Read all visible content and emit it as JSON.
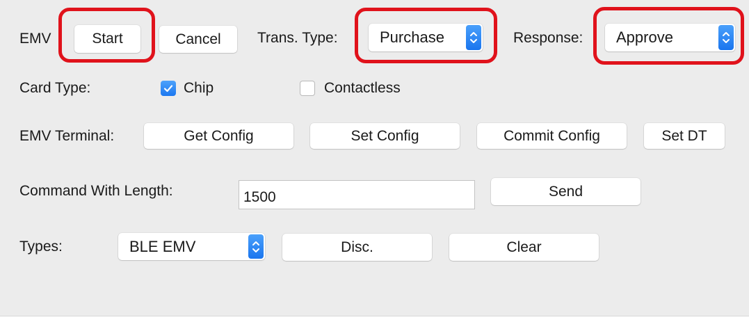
{
  "emv": {
    "label": "EMV",
    "start_button": "Start",
    "cancel_button": "Cancel"
  },
  "trans_type": {
    "label": "Trans. Type:",
    "selected": "Purchase"
  },
  "response": {
    "label": "Response:",
    "selected": "Approve"
  },
  "card_type": {
    "label": "Card Type:",
    "chip": {
      "label": "Chip",
      "checked": true
    },
    "contactless": {
      "label": "Contactless",
      "checked": false
    }
  },
  "emv_terminal": {
    "label": "EMV Terminal:",
    "get_config": "Get Config",
    "set_config": "Set Config",
    "commit_config": "Commit Config",
    "set_dt": "Set DT"
  },
  "command": {
    "label": "Command With Length:",
    "value": "1500",
    "send_button": "Send"
  },
  "types": {
    "label": "Types:",
    "selected": "BLE EMV",
    "disc_button": "Disc.",
    "clear_button": "Clear"
  },
  "colors": {
    "accent": "#1a75ee",
    "highlight": "#e0121b",
    "panel": "#ececec"
  }
}
